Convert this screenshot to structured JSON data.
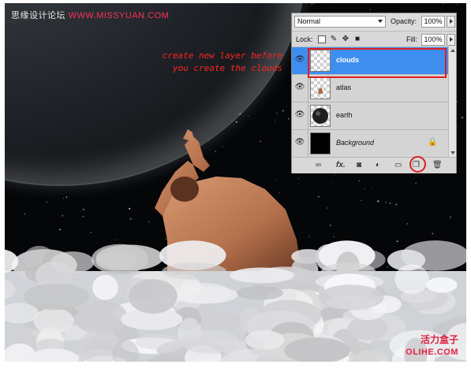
{
  "watermarks": {
    "top_cn": "思缘设计论坛",
    "top_site": "WWW.MISSYUAN.COM",
    "bottom_cn": "活力盒子",
    "bottom_en": "OLIHE.COM"
  },
  "annotation": {
    "line1": "create new layer before",
    "line2": "you create the clouds"
  },
  "layers_panel": {
    "blend_mode": "Normal",
    "opacity_label": "Opacity:",
    "opacity_value": "100%",
    "lock_label": "Lock:",
    "fill_label": "Fill:",
    "fill_value": "100%",
    "layers": [
      {
        "name": "clouds",
        "selected": true
      },
      {
        "name": "atlas",
        "selected": false
      },
      {
        "name": "earth",
        "selected": false
      },
      {
        "name": "Background",
        "selected": false,
        "locked": true
      }
    ],
    "bottom_icons": [
      "link-icon",
      "fx-icon",
      "mask-icon",
      "adjustment-icon",
      "group-folder-icon",
      "new-layer-icon",
      "trash-icon"
    ],
    "bottom_fx_label": "fx."
  },
  "colors": {
    "selection": "#3e8ef0",
    "annotation": "#ff2424",
    "highlight_outline": "#e11d1d"
  }
}
